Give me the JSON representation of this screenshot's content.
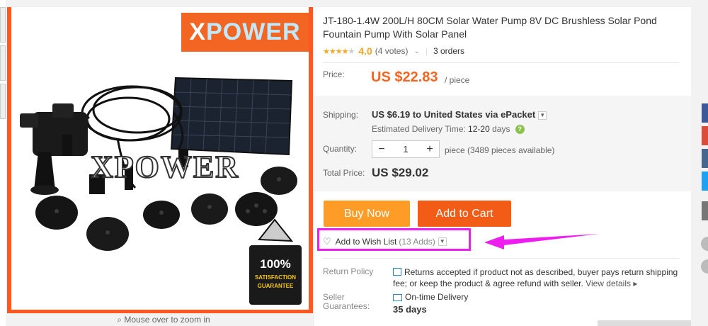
{
  "gallery": {
    "brand_prefix": "X",
    "brand_rest": "POWER",
    "watermark": "XPOWER",
    "badge_line1": "100%",
    "badge_line2": "SATISFACTION",
    "badge_line3": "GUARANTEE",
    "zoom_hint": "Mouse over to zoom in"
  },
  "product": {
    "title": "JT-180-1.4W 200L/H 80CM Solar Water Pump 8V DC Brushless Solar Pond Fountain Pump With Solar Panel",
    "rating_value": "4.0",
    "votes": "(4 votes)",
    "orders": "3 orders",
    "stars_filled": 4,
    "stars_total": 5
  },
  "price": {
    "label": "Price:",
    "value": "US $22.83",
    "unit": "/ piece"
  },
  "shipping": {
    "label": "Shipping:",
    "value": "US $6.19 to United States via ePacket",
    "est_label": "Estimated Delivery Time:",
    "est_days": "12-20",
    "est_unit": "days"
  },
  "quantity": {
    "label": "Quantity:",
    "minus": "−",
    "value": "1",
    "plus": "+",
    "available": "piece (3489 pieces available)"
  },
  "total": {
    "label": "Total Price:",
    "value": "US $29.02"
  },
  "actions": {
    "buy_now": "Buy Now",
    "add_to_cart": "Add to Cart",
    "wish_label": "Add to Wish List",
    "wish_adds": "(13 Adds)"
  },
  "returns": {
    "label": "Return Policy",
    "text": "Returns accepted if product not as described, buyer pays return shipping fee; or keep the product & agree refund with seller.",
    "view_details": "View details"
  },
  "guarantee": {
    "label": "Seller Guarantees:",
    "value": "On-time Delivery",
    "days": "35 days"
  },
  "colors": {
    "accent_orange": "#f26522",
    "buy_now": "#ff9c28",
    "add_to_cart": "#f25c16",
    "highlight_magenta": "#ee1fee",
    "star": "#f5a623"
  }
}
